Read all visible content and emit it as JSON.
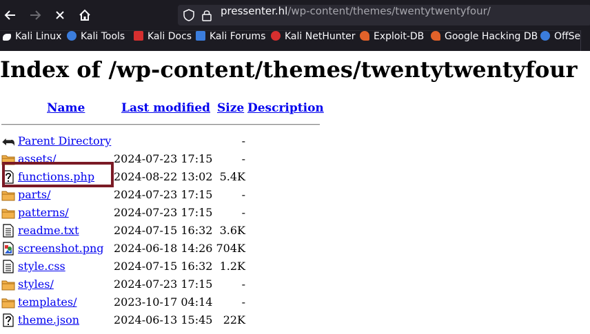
{
  "browser": {
    "url_host": "pressenter.hl",
    "url_path": "/wp-content/themes/twentytwentyfour/",
    "bookmarks": [
      {
        "label": "Kali Linux",
        "icon": "kali-dragon-icon",
        "color": "#ffffff"
      },
      {
        "label": "Kali Tools",
        "icon": "kali-tools-icon",
        "color": "#3b7ddd"
      },
      {
        "label": "Kali Docs",
        "icon": "kali-docs-icon",
        "color": "#d62f2f"
      },
      {
        "label": "Kali Forums",
        "icon": "kali-forums-icon",
        "color": "#3b7ddd"
      },
      {
        "label": "Kali NetHunter",
        "icon": "kali-nethunter-icon",
        "color": "#d62f2f"
      },
      {
        "label": "Exploit-DB",
        "icon": "exploit-db-icon",
        "color": "#e2622a"
      },
      {
        "label": "Google Hacking DB",
        "icon": "ghdb-icon",
        "color": "#e2622a"
      },
      {
        "label": "OffSec",
        "icon": "offsec-icon",
        "color": "#3b7ddd"
      }
    ]
  },
  "page": {
    "title": "Index of /wp-content/themes/twentytwentyfour",
    "columns": {
      "name": "Name",
      "last_modified": "Last modified",
      "size": "Size",
      "description": "Description"
    },
    "rows": [
      {
        "name": "Parent Directory",
        "date": "",
        "size": "-",
        "icon": "parent-directory-icon"
      },
      {
        "name": "assets/",
        "date": "2024-07-23 17:15",
        "size": "-",
        "icon": "folder-icon"
      },
      {
        "name": "functions.php",
        "date": "2024-08-22 13:02",
        "size": "5.4K",
        "icon": "unknown-file-icon"
      },
      {
        "name": "parts/",
        "date": "2024-07-23 17:15",
        "size": "-",
        "icon": "folder-icon"
      },
      {
        "name": "patterns/",
        "date": "2024-07-23 17:15",
        "size": "-",
        "icon": "folder-icon"
      },
      {
        "name": "readme.txt",
        "date": "2024-07-15 16:32",
        "size": "3.6K",
        "icon": "text-file-icon"
      },
      {
        "name": "screenshot.png",
        "date": "2024-06-18 14:26",
        "size": "704K",
        "icon": "image-file-icon"
      },
      {
        "name": "style.css",
        "date": "2024-07-15 16:32",
        "size": "1.2K",
        "icon": "text-file-icon"
      },
      {
        "name": "styles/",
        "date": "2024-07-23 17:15",
        "size": "-",
        "icon": "folder-icon"
      },
      {
        "name": "templates/",
        "date": "2023-10-17 04:14",
        "size": "-",
        "icon": "folder-icon"
      },
      {
        "name": "theme.json",
        "date": "2024-06-13 15:45",
        "size": "22K",
        "icon": "unknown-file-icon"
      }
    ]
  },
  "colors": {
    "link": "#0000ee",
    "highlight_border": "#7a1a25",
    "chrome_bg": "#1c1b22"
  }
}
